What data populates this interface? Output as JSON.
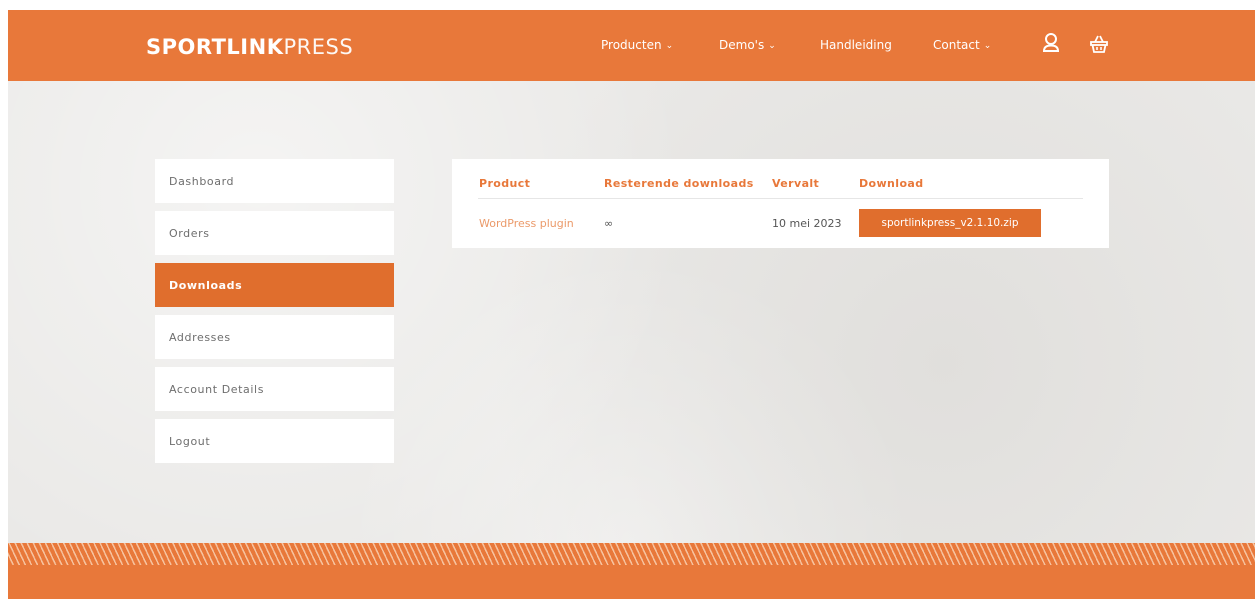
{
  "brand": {
    "name_bold": "SPORTLINK",
    "name_light": "PRESS",
    "color": "#e8783a"
  },
  "nav": {
    "items": [
      {
        "label": "Producten",
        "has_dropdown": true
      },
      {
        "label": "Demo's",
        "has_dropdown": true
      },
      {
        "label": "Handleiding",
        "has_dropdown": false
      },
      {
        "label": "Contact",
        "has_dropdown": true
      }
    ],
    "chevron": "⌄",
    "icons": [
      "user-icon",
      "basket-icon"
    ]
  },
  "account_menu": {
    "items": [
      {
        "label": "Dashboard",
        "active": false
      },
      {
        "label": "Orders",
        "active": false
      },
      {
        "label": "Downloads",
        "active": true
      },
      {
        "label": "Addresses",
        "active": false
      },
      {
        "label": "Account Details",
        "active": false
      },
      {
        "label": "Logout",
        "active": false
      }
    ],
    "active_color": "#e06e2d"
  },
  "downloads_table": {
    "headers": {
      "product": "Product",
      "remaining": "Resterende downloads",
      "expires": "Vervalt",
      "download": "Download"
    },
    "rows": [
      {
        "product": "WordPress plugin",
        "remaining": "∞",
        "expires": "10 mei 2023",
        "file": "sportlinkpress_v2.1.10.zip"
      }
    ]
  }
}
